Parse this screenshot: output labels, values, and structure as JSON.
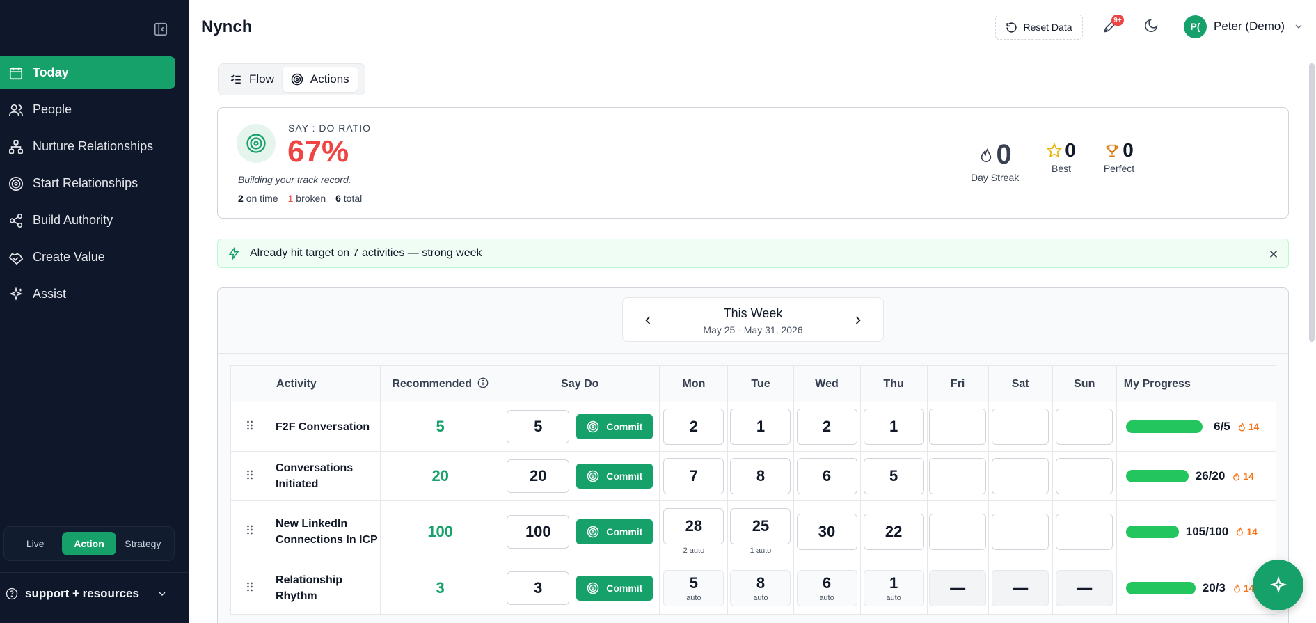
{
  "app": {
    "title": "Nynch"
  },
  "header": {
    "reset_label": "Reset Data",
    "notif_badge": "9+",
    "user": {
      "initials": "P(",
      "name": "Peter (Demo)"
    }
  },
  "sidebar": {
    "items": [
      {
        "label": "Today",
        "icon": "calendar-icon",
        "active": true
      },
      {
        "label": "People",
        "icon": "users-icon"
      },
      {
        "label": "Nurture Relationships",
        "icon": "network-icon"
      },
      {
        "label": "Start Relationships",
        "icon": "target-icon"
      },
      {
        "label": "Build Authority",
        "icon": "share-icon"
      },
      {
        "label": "Create Value",
        "icon": "handshake-icon"
      },
      {
        "label": "Assist",
        "icon": "sparkles-icon"
      }
    ],
    "modes": [
      "Live",
      "Action",
      "Strategy"
    ],
    "active_mode": "Action",
    "support_label": "support + resources"
  },
  "tabs": [
    {
      "label": "Flow",
      "icon": "list-check-icon"
    },
    {
      "label": "Actions",
      "icon": "target-icon",
      "active": true
    }
  ],
  "ratio": {
    "label": "SAY : DO RATIO",
    "value": "67%",
    "note": "Building your track record.",
    "on_time": "2",
    "on_time_label": "on time",
    "broken": "1",
    "broken_label": "broken",
    "total": "6",
    "total_label": "total",
    "day_streak": "0",
    "day_streak_label": "Day Streak",
    "best": "0",
    "best_label": "Best",
    "perfect": "0",
    "perfect_label": "Perfect"
  },
  "alert": {
    "text": "Already hit target on 7 activities — strong week"
  },
  "week": {
    "title": "This Week",
    "range": "May 25 - May 31, 2026"
  },
  "table": {
    "headers": {
      "activity": "Activity",
      "recommended": "Recommended",
      "saydo": "Say Do",
      "mon": "Mon",
      "tue": "Tue",
      "wed": "Wed",
      "thu": "Thu",
      "fri": "Fri",
      "sat": "Sat",
      "sun": "Sun",
      "progress": "My Progress"
    },
    "commit_label": "Commit",
    "rows": [
      {
        "activity": "F2F Conversation",
        "recommended": "5",
        "say": "5",
        "mon": "2",
        "tue": "1",
        "wed": "2",
        "thu": "1",
        "progress": "6/5",
        "progress_fraction": 1.0,
        "streak": "14"
      },
      {
        "activity": "Conversations Initiated",
        "recommended": "20",
        "say": "20",
        "mon": "7",
        "tue": "8",
        "wed": "6",
        "thu": "5",
        "progress": "26/20",
        "progress_fraction": 1.0,
        "streak": "14"
      },
      {
        "activity": "New LinkedIn Connections In ICP",
        "recommended": "100",
        "say": "100",
        "mon": "28",
        "mon_sub": "2 auto",
        "tue": "25",
        "tue_sub": "1 auto",
        "wed": "30",
        "thu": "22",
        "progress": "105/100",
        "progress_fraction": 1.0,
        "streak": "14"
      },
      {
        "activity": "Relationship Rhythm",
        "recommended": "3",
        "say": "3",
        "mon": "5",
        "tue": "8",
        "wed": "6",
        "thu": "1",
        "auto_label": "auto",
        "fri": "—",
        "sat": "—",
        "sun": "—",
        "progress": "20/3",
        "progress_fraction": 1.0,
        "streak": "14"
      }
    ]
  },
  "colors": {
    "accent": "#16a06a",
    "danger": "#ef4444",
    "sidebar": "#0f172a",
    "progress": "#22c55e"
  }
}
